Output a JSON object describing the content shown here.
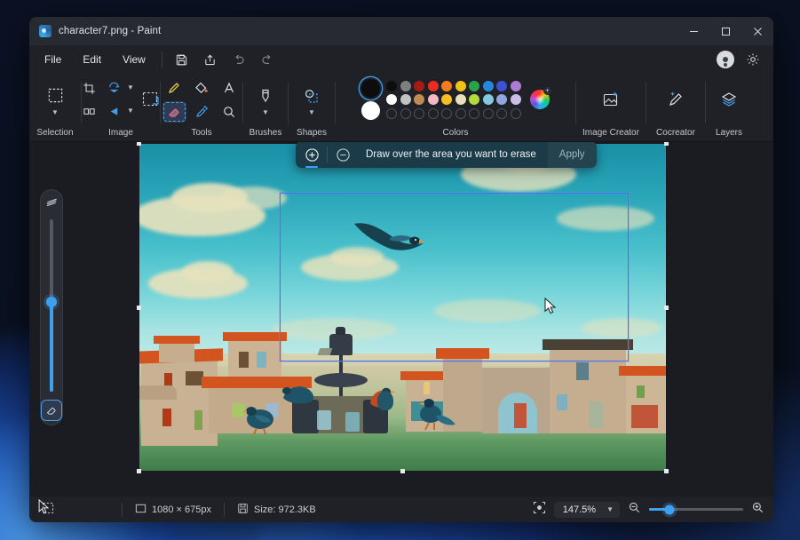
{
  "window": {
    "title": "character7.png - Paint",
    "app_icon": "paint-icon",
    "controls": {
      "minimize": "—",
      "maximize": "□",
      "close": "✕"
    }
  },
  "menubar": {
    "items": [
      {
        "label": "File",
        "name": "menu-file"
      },
      {
        "label": "Edit",
        "name": "menu-edit"
      },
      {
        "label": "View",
        "name": "menu-view"
      }
    ],
    "buttons": [
      {
        "name": "save-button",
        "icon": "save-icon"
      },
      {
        "name": "share-button",
        "icon": "share-icon"
      },
      {
        "name": "undo-button",
        "icon": "undo-icon"
      },
      {
        "name": "redo-button",
        "icon": "redo-icon"
      }
    ],
    "right": [
      {
        "name": "account-button",
        "icon": "account-icon"
      },
      {
        "name": "settings-button",
        "icon": "gear-icon"
      }
    ]
  },
  "ribbon": {
    "groups": [
      {
        "label": "Selection",
        "name": "ribbon-group-selection"
      },
      {
        "label": "Image",
        "name": "ribbon-group-image"
      },
      {
        "label": "Tools",
        "name": "ribbon-group-tools"
      },
      {
        "label": "Brushes",
        "name": "ribbon-group-brushes"
      },
      {
        "label": "Shapes",
        "name": "ribbon-group-shapes"
      },
      {
        "label": "Colors",
        "name": "ribbon-group-colors"
      },
      {
        "label": "Image Creator",
        "name": "ribbon-group-image-creator"
      },
      {
        "label": "Cocreator",
        "name": "ribbon-group-cocreator"
      },
      {
        "label": "Layers",
        "name": "ribbon-group-layers"
      }
    ],
    "tools": {
      "selected": "eraser-tool",
      "items": [
        "pencil-tool",
        "fill-tool",
        "text-tool",
        "eraser-tool",
        "eyedropper-tool",
        "magnifier-tool"
      ]
    },
    "colors": {
      "primary": "#0d0d0d",
      "secondary": "#ffffff",
      "row1": [
        "#0d0d0d",
        "#7f7f7f",
        "#a61b12",
        "#ee2b20",
        "#f07c1a",
        "#f2c317",
        "#2aa44c",
        "#2488dd",
        "#3f4fd6",
        "#b07bd4"
      ],
      "row2": [
        "#ffffff",
        "#c2c2c2",
        "#c08a55",
        "#f3b9c6",
        "#f6bf22",
        "#e6e0bb",
        "#b6d93e",
        "#82c8e0",
        "#8fa7de",
        "#cbbfe6"
      ],
      "row3_empty_count": 10,
      "wheel_badge": "+"
    }
  },
  "eraser_panel": {
    "name": "eraser-size-panel",
    "top_icon": "brush-size-icon",
    "bottom_icon": "eraser-icon",
    "slider_value_pct": 52
  },
  "erase_toolbar": {
    "add_button": "add-area-icon",
    "subtract_button": "subtract-area-icon",
    "message": "Draw over the area you want to erase",
    "apply_label": "Apply",
    "active": "add"
  },
  "canvas": {
    "name": "image-canvas",
    "selection_rect": {
      "name": "selection-marquee",
      "color": "#4472f0"
    },
    "scene": {
      "description": "painted mediterranean village plaza with birds under blue sky"
    }
  },
  "statusbar": {
    "selection_icon": "selection-icon",
    "dimensions_icon": "image-size-icon",
    "dimensions": "1080 × 675px",
    "size_icon": "file-size-icon",
    "size": "Size: 972.3KB",
    "fit_icon": "fit-to-window-icon",
    "zoom_value": "147.5%",
    "zoom_chevron": "chevron-down-icon",
    "zoom_out_icon": "zoom-out-icon",
    "zoom_in_icon": "zoom-in-icon",
    "zoom_slider_pct": 22
  }
}
